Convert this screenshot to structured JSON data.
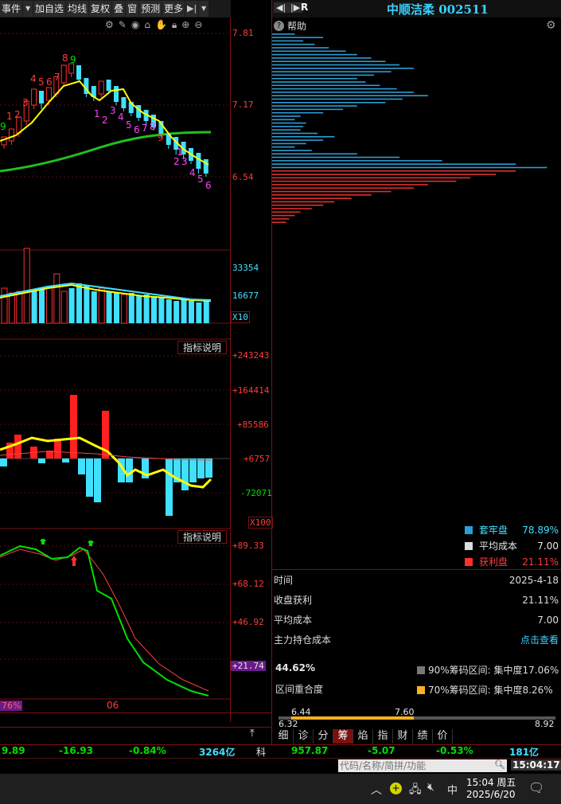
{
  "toolbar": {
    "items": [
      "事件",
      "加自选",
      "均线",
      "复权",
      "叠",
      "窗",
      "预测",
      "更多"
    ]
  },
  "stock": {
    "name": "中顺洁柔",
    "code": "002511",
    "tag": "R"
  },
  "help_label": "帮助",
  "price_axis": [
    "7.81",
    "7.17",
    "6.54"
  ],
  "volume_axis": [
    "33354",
    "16677",
    "X10"
  ],
  "ind1": {
    "button": "指标说明",
    "axis": [
      "+243243",
      "+164414",
      "+85586",
      "+6757",
      "-72071",
      "X100"
    ]
  },
  "ind2": {
    "button": "指标说明",
    "axis": [
      "+89.33",
      "+68.12",
      "+46.92",
      "+21.74"
    ]
  },
  "bottom_left_pct": "76%",
  "x_axis_label": "06",
  "candle_counts": {
    "up": [
      "9",
      "1",
      "2",
      "3",
      "4",
      "5",
      "6",
      "7",
      "8",
      "9"
    ],
    "down": [
      "1",
      "2",
      "3",
      "4",
      "5",
      "6",
      "7",
      "8",
      "9",
      "1",
      "2",
      "3",
      "4",
      "5",
      "6"
    ]
  },
  "legend": [
    {
      "label": "套牢盘",
      "value": "78.89%",
      "color": "#2a9fd6",
      "value_class": "cyan"
    },
    {
      "label": "平均成本",
      "value": "7.00",
      "color": "#dddddd",
      "value_class": "white"
    },
    {
      "label": "获利盘",
      "value": "21.11%",
      "color": "#ff3030",
      "value_class": "red"
    }
  ],
  "info": [
    {
      "label": "时间",
      "value": "2025-4-18"
    },
    {
      "label": "收盘获利",
      "value": "21.11%"
    },
    {
      "label": "平均成本",
      "value": "7.00"
    },
    {
      "label": "主力持仓成本",
      "value": "点击查看"
    }
  ],
  "concentration": {
    "overlap_value": "44.62%",
    "overlap_label": "区间重合度",
    "r90": "90%筹码区间: 集中度17.06%",
    "r70": "70%筹码区间: 集中度8.26%"
  },
  "range_bar": {
    "lo": "6.44",
    "hi": "7.60",
    "min": "6.32",
    "max": "8.92"
  },
  "tabs": [
    "细",
    "诊",
    "分",
    "筹",
    "焰",
    "指",
    "财",
    "绩",
    "价"
  ],
  "ticker": {
    "a1": "9.89",
    "a2": "-16.93",
    "a3": "-0.84%",
    "a4": "3264亿",
    "sep": "科",
    "b1": "957.87",
    "b2": "-5.07",
    "b3": "-0.53%",
    "b4": "181亿"
  },
  "search_placeholder": "代码/名称/简拼/功能",
  "clock": "15:04:17",
  "taskbar": {
    "ime": "中",
    "time": "15:04 周五",
    "date": "2025/6/20"
  },
  "chip_distribution": {
    "note": "bar lengths as fraction of panel width, top to bottom; blue=loss, red=profit",
    "bars": [
      0.08,
      0.18,
      0.11,
      0.15,
      0.2,
      0.26,
      0.3,
      0.35,
      0.4,
      0.45,
      0.5,
      0.42,
      0.36,
      0.3,
      0.33,
      0.38,
      0.44,
      0.5,
      0.55,
      0.46,
      0.4,
      0.3,
      0.25,
      0.18,
      0.1,
      0.08,
      0.12,
      0.11,
      0.1,
      0.16,
      0.22,
      0.18,
      0.12,
      0.08,
      0.14,
      0.3,
      0.45,
      0.6,
      0.86,
      0.97,
      0.86,
      0.79,
      0.7,
      0.65,
      0.55,
      0.5,
      0.42,
      0.35,
      0.28,
      0.22,
      0.18,
      0.14,
      0.1,
      0.08,
      0.06,
      0.05
    ]
  }
}
